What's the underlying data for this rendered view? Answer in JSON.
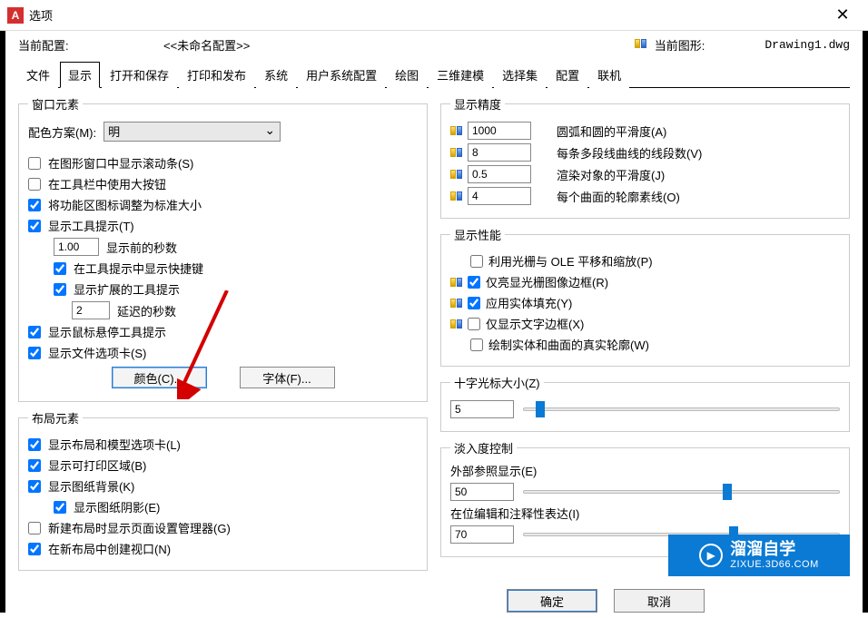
{
  "title": "选项",
  "profile_label": "当前配置:",
  "profile_name": "<<未命名配置>>",
  "drawing_label": "当前图形:",
  "drawing_name": "Drawing1.dwg",
  "tabs": [
    "文件",
    "显示",
    "打开和保存",
    "打印和发布",
    "系统",
    "用户系统配置",
    "绘图",
    "三维建模",
    "选择集",
    "配置",
    "联机"
  ],
  "active_tab": 1,
  "window_elements": {
    "legend": "窗口元素",
    "color_scheme_label": "配色方案(M):",
    "color_scheme_value": "明",
    "show_scroll": "在图形窗口中显示滚动条(S)",
    "large_buttons": "在工具栏中使用大按钮",
    "resize_ribbon": "将功能区图标调整为标准大小",
    "show_tooltips": "显示工具提示(T)",
    "seconds_before": "显示前的秒数",
    "seconds_before_val": "1.00",
    "show_shortcut": "在工具提示中显示快捷键",
    "show_extended": "显示扩展的工具提示",
    "delay_seconds": "延迟的秒数",
    "delay_val": "2",
    "show_rollover": "显示鼠标悬停工具提示",
    "show_filetabs": "显示文件选项卡(S)",
    "colors_btn": "颜色(C)...",
    "fonts_btn": "字体(F)..."
  },
  "layout_elements": {
    "legend": "布局元素",
    "show_tabs": "显示布局和模型选项卡(L)",
    "show_printable": "显示可打印区域(B)",
    "show_paper_bg": "显示图纸背景(K)",
    "show_paper_shadow": "显示图纸阴影(E)",
    "new_layout_setup": "新建布局时显示页面设置管理器(G)",
    "create_viewport": "在新布局中创建视口(N)"
  },
  "display_resolution": {
    "legend": "显示精度",
    "arc_val": "1000",
    "arc_lbl": "圆弧和圆的平滑度(A)",
    "seg_val": "8",
    "seg_lbl": "每条多段线曲线的线段数(V)",
    "render_val": "0.5",
    "render_lbl": "渲染对象的平滑度(J)",
    "surf_val": "4",
    "surf_lbl": "每个曲面的轮廓素线(O)"
  },
  "display_performance": {
    "legend": "显示性能",
    "pan_zoom": "利用光栅与 OLE 平移和缩放(P)",
    "highlight_raster": "仅亮显光栅图像边框(R)",
    "apply_solid": "应用实体填充(Y)",
    "text_frame": "仅显示文字边框(X)",
    "true_silhouettes": "绘制实体和曲面的真实轮廓(W)"
  },
  "crosshair": {
    "legend": "十字光标大小(Z)",
    "val": "5"
  },
  "fade": {
    "legend": "淡入度控制",
    "xref_lbl": "外部参照显示(E)",
    "xref_val": "50",
    "inplace_lbl": "在位编辑和注释性表达(I)",
    "inplace_val": "70"
  },
  "buttons": {
    "ok": "确定",
    "cancel": "取消"
  },
  "watermark": {
    "name": "溜溜自学",
    "url": "ZIXUE.3D66.COM"
  }
}
